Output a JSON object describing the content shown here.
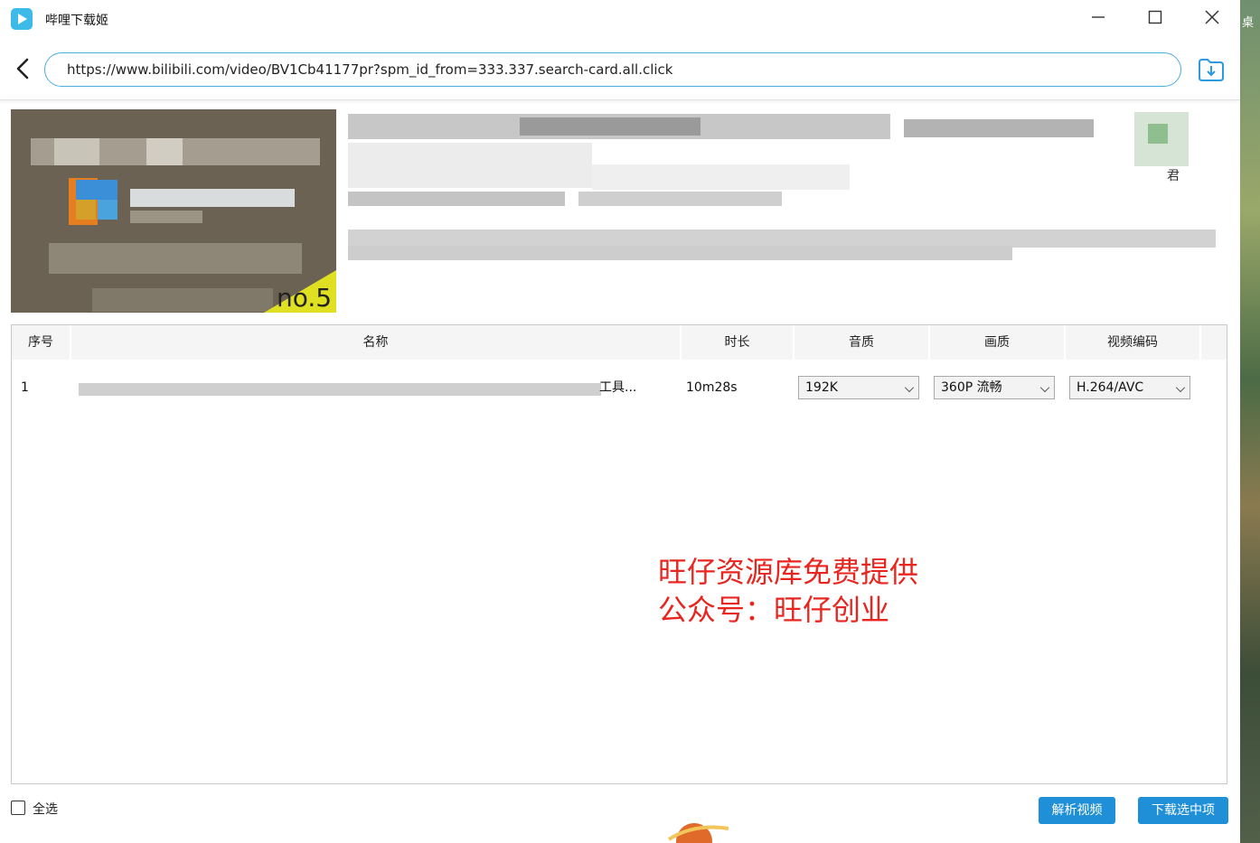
{
  "app": {
    "title": "哔哩下载姬"
  },
  "window_controls": {
    "minimize": "—",
    "maximize": "☐",
    "close": "✕"
  },
  "address_bar": {
    "url": "https://www.bilibili.com/video/BV1Cb41177pr?spm_id_from=333.337.search-card.all.click"
  },
  "video_info": {
    "thumbnail_badge": "no.5",
    "uploader_suffix": "君"
  },
  "table": {
    "headers": [
      "序号",
      "名称",
      "时长",
      "音质",
      "画质",
      "视频编码"
    ],
    "rows": [
      {
        "index": "1",
        "name_visible": "工具...",
        "duration": "10m28s",
        "audio": "192K",
        "video": "360P 流畅",
        "codec": "H.264/AVC"
      }
    ]
  },
  "watermark": {
    "line1": "旺仔资源库免费提供",
    "line2": "公众号：旺仔创业"
  },
  "footer": {
    "select_all": "全选",
    "parse_button": "解析视频",
    "download_button": "下载选中项"
  },
  "desktop": {
    "label": "桌"
  },
  "colors": {
    "accent": "#1f8fd8",
    "url_border": "#49aee0",
    "watermark": "#e8251f"
  }
}
